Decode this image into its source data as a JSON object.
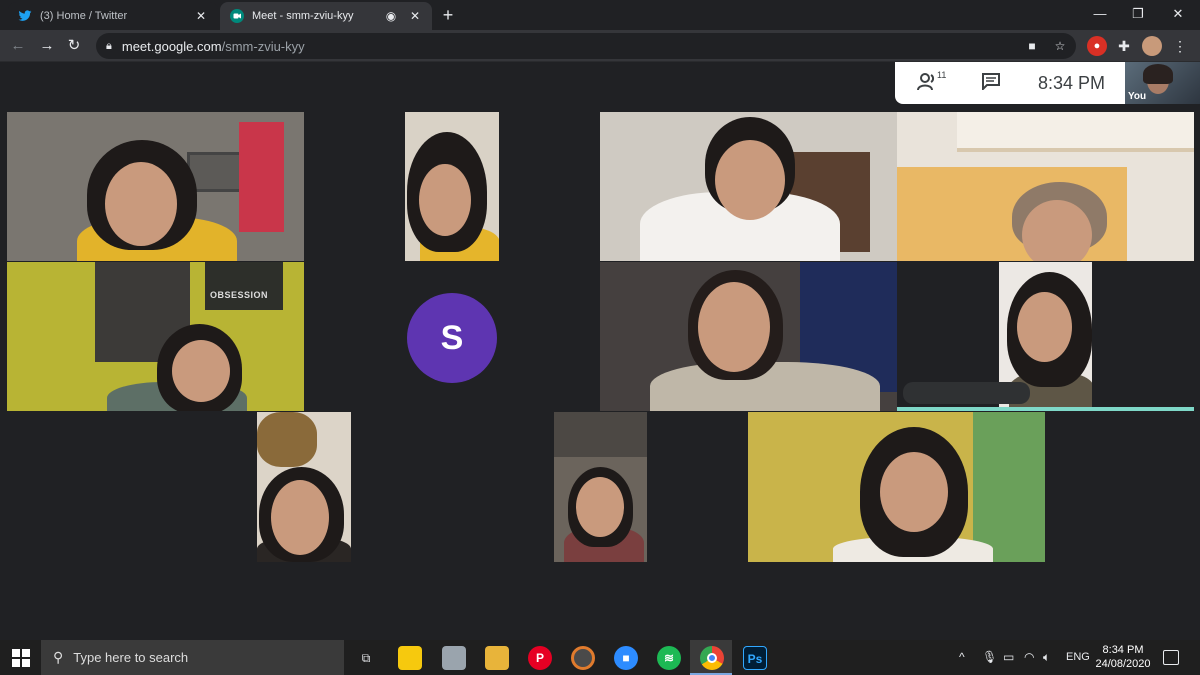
{
  "browser": {
    "tabs": [
      {
        "title": "(3) Home / Twitter",
        "icon": "twitter-icon",
        "active": false
      },
      {
        "title": "Meet - smm-zviu-kyy",
        "icon": "google-meet-icon",
        "active": true
      }
    ],
    "url_host": "meet.google.com",
    "url_path": "/smm-zviu-kyy"
  },
  "meet": {
    "participant_count": "11",
    "time": "8:34 PM",
    "self_label": "You",
    "avatar_letter": "S",
    "poster_text": "OBSESSION"
  },
  "taskbar": {
    "search_placeholder": "Type here to search",
    "language": "ENG",
    "time": "8:34 PM",
    "date": "24/08/2020"
  },
  "colors": {
    "meet_background": "#202124",
    "avatar": "#5e35b1",
    "speaking_indicator": "#7fd8c8"
  }
}
